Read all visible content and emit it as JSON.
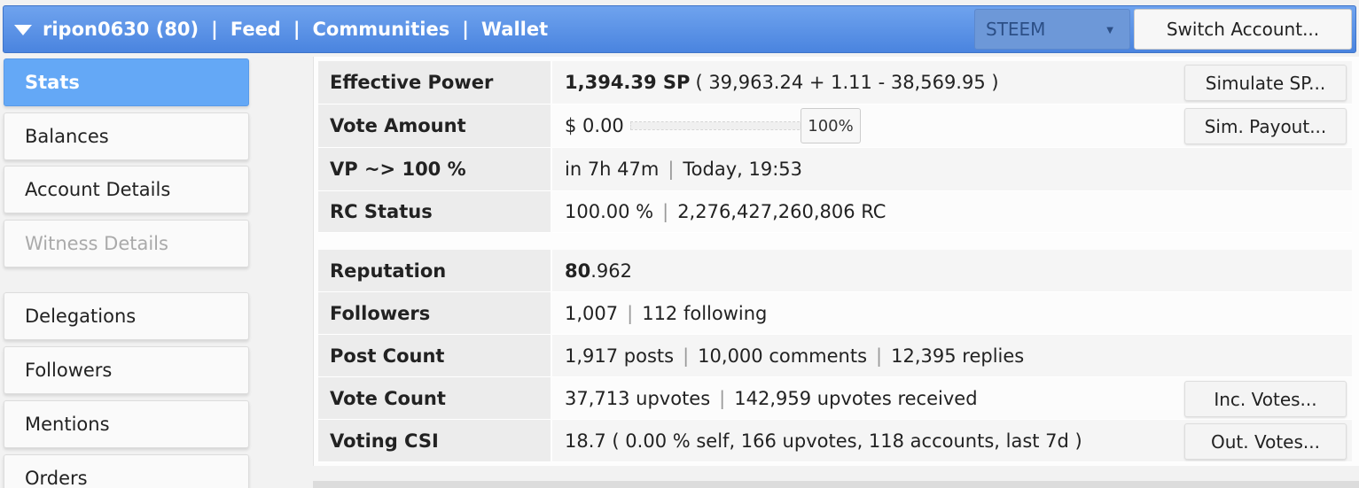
{
  "header": {
    "account": "ripon0630 (80)",
    "links": [
      "Feed",
      "Communities",
      "Wallet"
    ],
    "token": "STEEM",
    "switch_account": "Switch Account..."
  },
  "sidebar": {
    "items": [
      {
        "label": "Stats",
        "active": true
      },
      {
        "label": "Balances"
      },
      {
        "label": "Account Details"
      },
      {
        "label": "Witness Details",
        "disabled": true
      },
      {
        "label": "Delegations"
      },
      {
        "label": "Followers"
      },
      {
        "label": "Mentions"
      },
      {
        "label": "Orders"
      }
    ]
  },
  "stats": {
    "effective_power": {
      "label": "Effective Power",
      "sp": "1,394.39 SP",
      "detail": "( 39,963.24 + 1.11 - 38,569.95 )",
      "button": "Simulate SP..."
    },
    "vote_amount": {
      "label": "Vote Amount",
      "value": "$ 0.00",
      "percent": "100%",
      "level": 100,
      "button": "Sim. Payout..."
    },
    "vp": {
      "label": "VP ~> 100 %",
      "time": "in 7h 47m",
      "when": "Today, 19:53"
    },
    "rc_status": {
      "label": "RC Status",
      "percent": "100.00 %",
      "rc": "2,276,427,260,806 RC"
    },
    "reputation": {
      "label": "Reputation",
      "int": "80",
      "frac": ".962"
    },
    "followers": {
      "label": "Followers",
      "count": "1,007",
      "following": "112 following"
    },
    "post_count": {
      "label": "Post Count",
      "posts": "1,917 posts",
      "comments": "10,000 comments",
      "replies": "12,395 replies"
    },
    "vote_count": {
      "label": "Vote Count",
      "upvotes": "37,713 upvotes",
      "received": "142,959 upvotes received",
      "button": "Inc. Votes..."
    },
    "voting_csi": {
      "label": "Voting CSI",
      "value": "18.7 ( 0.00 % self, 166 upvotes, 118 accounts, last 7d )",
      "button": "Out. Votes..."
    }
  },
  "colors": {
    "header": "#4a84df",
    "active": "#64a8f6"
  }
}
